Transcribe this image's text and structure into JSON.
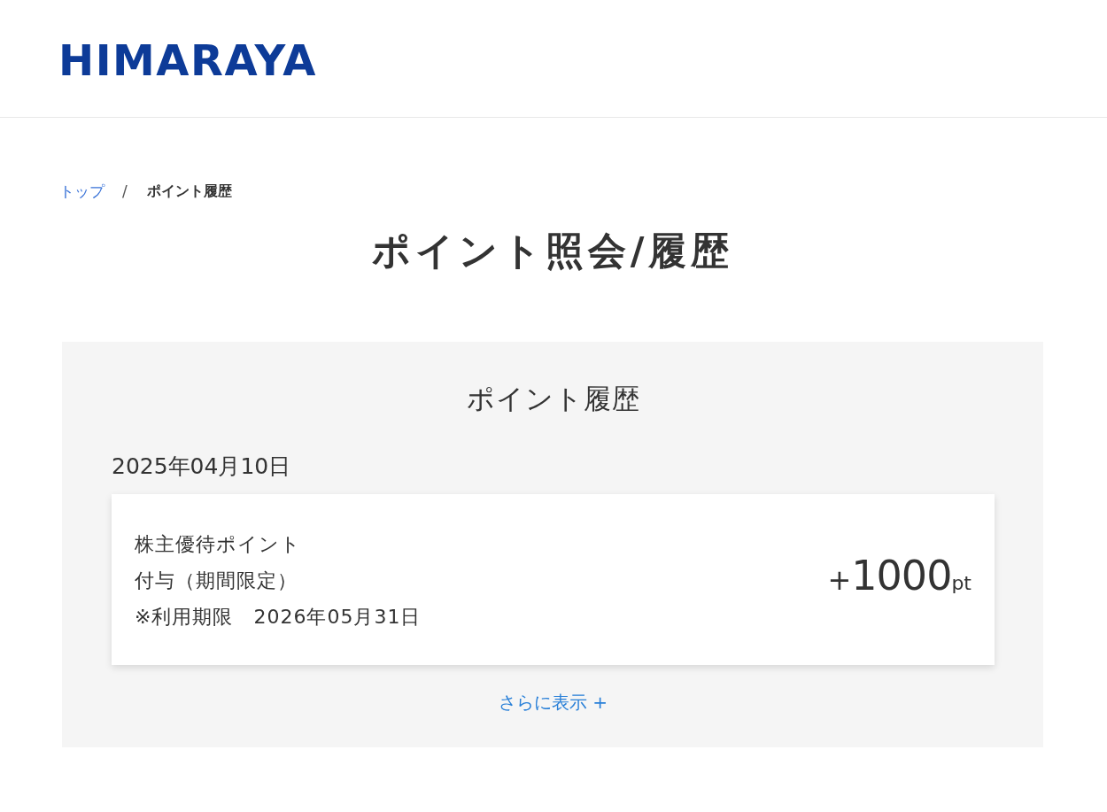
{
  "header": {
    "logo": "HIMARAYA"
  },
  "breadcrumb": {
    "items": [
      {
        "label": "トップ",
        "kind": "link"
      },
      {
        "label": "ポイント履歴",
        "kind": "current"
      }
    ],
    "separator": "/"
  },
  "page_title": "ポイント照会/履歴",
  "history": {
    "title": "ポイント履歴",
    "groups": [
      {
        "date": "2025年04月10日",
        "entries": [
          {
            "name": "株主優待ポイント",
            "type": "付与（期間限定）",
            "expiry": "※利用期限　2026年05月31日",
            "amount": {
              "sign": "+",
              "value": "1000",
              "unit": "pt"
            }
          }
        ]
      }
    ],
    "more_link": "さらに表示 +"
  }
}
